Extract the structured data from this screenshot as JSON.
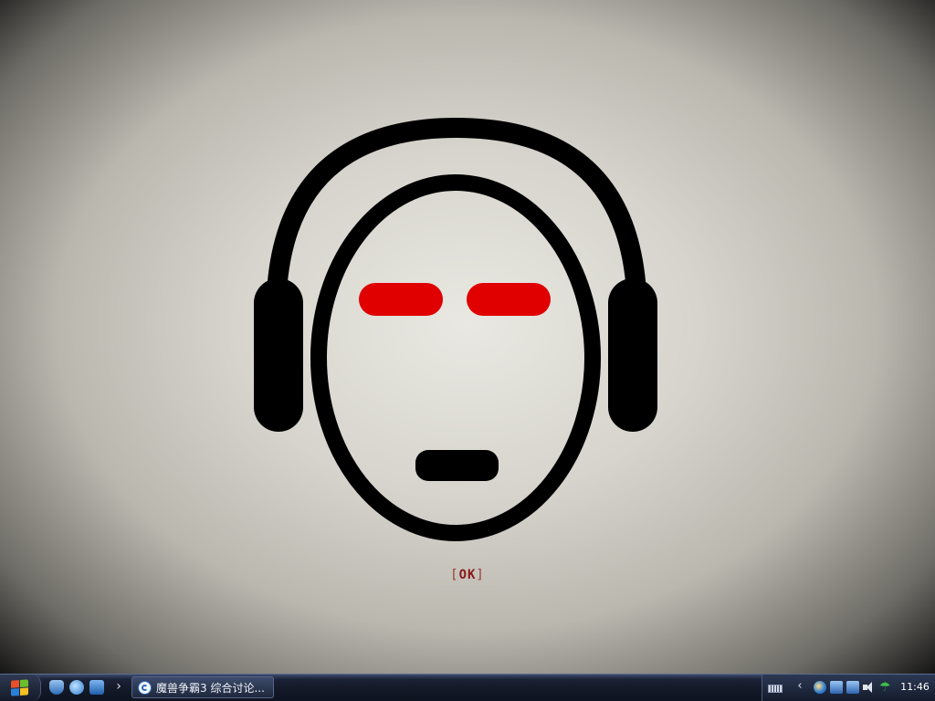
{
  "wallpaper": {
    "caption_bracket_open": "[",
    "caption_text": "OK",
    "caption_bracket_close": "]",
    "colors": {
      "eye_red": "#e00000",
      "ink": "#000000",
      "caption_red": "#8a1818"
    }
  },
  "taskbar": {
    "start_icon": "windows-flag-icon",
    "quick_launch": [
      {
        "icon": "shield-icon"
      },
      {
        "icon": "internet-explorer-icon"
      },
      {
        "icon": "show-desktop-icon"
      }
    ],
    "quick_launch_more": "›",
    "window_button": {
      "icon": "browser-app-icon",
      "title": "魔兽争霸3 综合讨论..."
    },
    "tray": {
      "expand": "‹",
      "icons": [
        "keyboard-icon",
        "ie-tray-icon",
        "network-icon",
        "network-icon",
        "volume-icon",
        "umbrella-icon"
      ],
      "umbrella_glyph": "☂",
      "clock": "11:46"
    }
  }
}
